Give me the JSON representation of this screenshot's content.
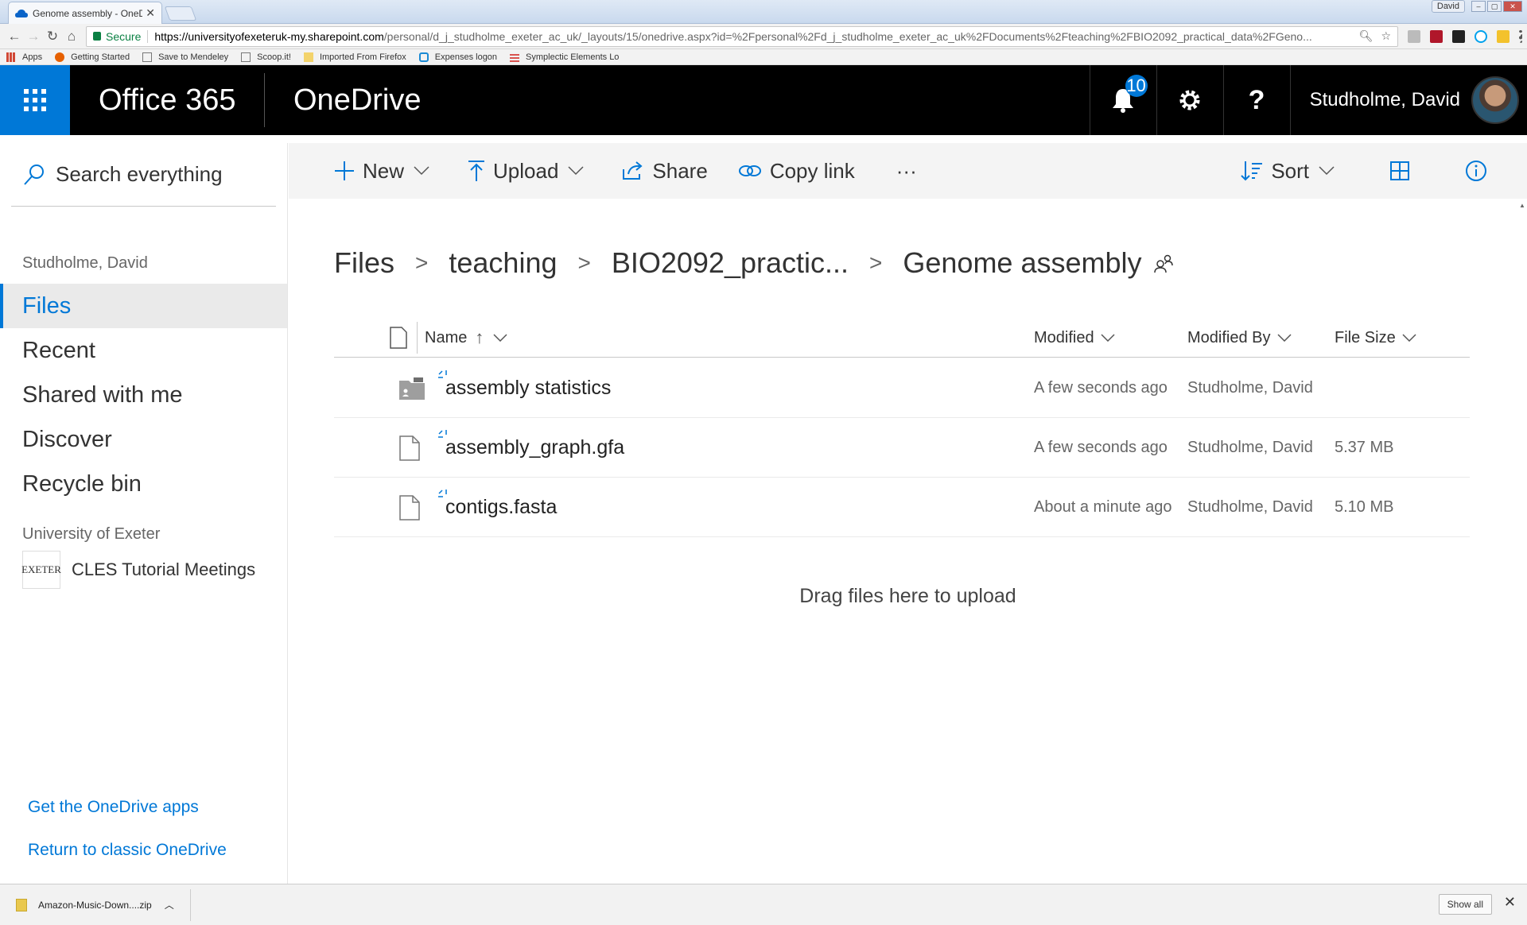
{
  "browser": {
    "tab_title": "Genome assembly - OneDr",
    "window_user": "David",
    "secure_label": "Secure",
    "url_domain": "https://universityofexeteruk-my.sharepoint.com",
    "url_path": "/personal/d_j_studholme_exeter_ac_uk/_layouts/15/onedrive.aspx?id=%2Fpersonal%2Fd_j_studholme_exeter_ac_uk%2FDocuments%2Fteaching%2FBIO2092_practical_data%2FGeno...",
    "bookmarks": [
      "Apps",
      "Getting Started",
      "Save to Mendeley",
      "Scoop.it!",
      "Imported From Firefox",
      "Expenses logon",
      "Symplectic Elements Lo"
    ]
  },
  "suite": {
    "brand": "Office 365",
    "app": "OneDrive",
    "notification_count": "10",
    "help_label": "?",
    "user_name": "Studholme, David"
  },
  "leftnav": {
    "search_placeholder": "Search everything",
    "owner": "Studholme, David",
    "items": [
      {
        "label": "Files",
        "selected": true
      },
      {
        "label": "Recent"
      },
      {
        "label": "Shared with me"
      },
      {
        "label": "Discover"
      },
      {
        "label": "Recycle bin"
      }
    ],
    "org_heading": "University of Exeter",
    "site_logo_text": "EXETER",
    "site_name": "CLES Tutorial Meetings",
    "get_apps": "Get the OneDrive apps",
    "return_classic": "Return to classic OneDrive"
  },
  "commands": {
    "new": "New",
    "upload": "Upload",
    "share": "Share",
    "copy_link": "Copy link",
    "more": "···",
    "sort": "Sort"
  },
  "breadcrumb": [
    "Files",
    "teaching",
    "BIO2092_practic...",
    "Genome assembly"
  ],
  "columns": {
    "name": "Name",
    "modified": "Modified",
    "modified_by": "Modified By",
    "file_size": "File Size"
  },
  "files": [
    {
      "name": "assembly statistics",
      "type": "folder",
      "modified": "A few seconds ago",
      "modified_by": "Studholme, David",
      "size": ""
    },
    {
      "name": "assembly_graph.gfa",
      "type": "file",
      "modified": "A few seconds ago",
      "modified_by": "Studholme, David",
      "size": "5.37 MB"
    },
    {
      "name": "contigs.fasta",
      "type": "file",
      "modified": "About a minute ago",
      "modified_by": "Studholme, David",
      "size": "5.10 MB"
    }
  ],
  "drop_message": "Drag files here to upload",
  "downloads": {
    "file": "Amazon-Music-Down....zip",
    "show_all": "Show all"
  },
  "colors": {
    "accent": "#0078d7",
    "suite_bg": "#000000"
  }
}
